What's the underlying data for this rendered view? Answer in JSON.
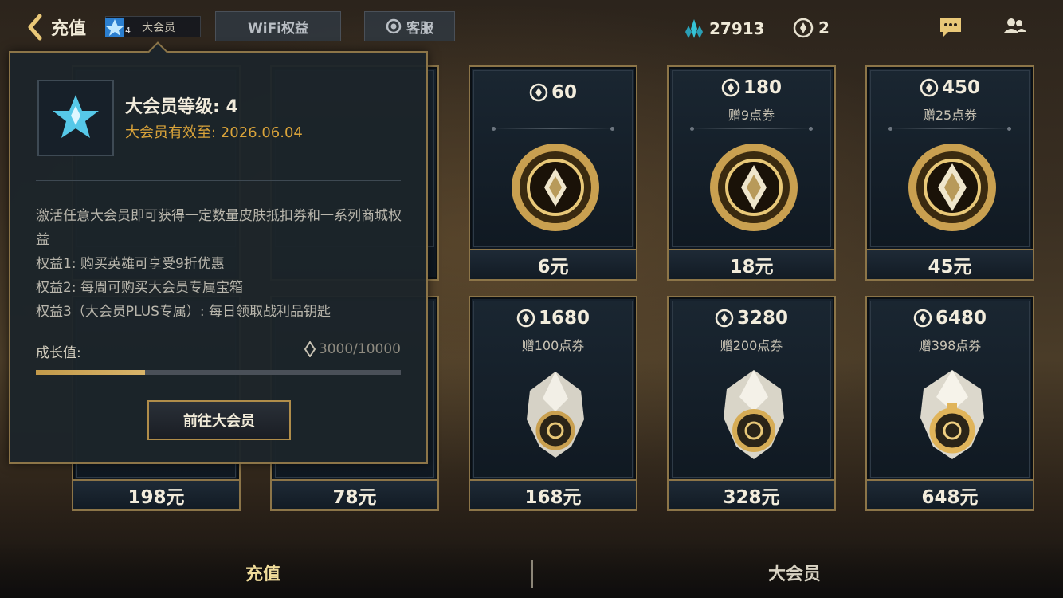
{
  "header": {
    "title": "充值",
    "vip_chip": {
      "level": "4",
      "label": "大会员"
    },
    "wifi_tab": "WiFi权益",
    "service_tab": "客服",
    "diamonds": "27913",
    "coupons": "2"
  },
  "cards": [
    {
      "amount": "",
      "bonus": "",
      "price": "198元",
      "visible": "partial"
    },
    {
      "amount": "",
      "bonus": "",
      "price": "78元",
      "visible": "partial"
    },
    {
      "amount": "60",
      "bonus": "",
      "price": "6元"
    },
    {
      "amount": "180",
      "bonus": "赠9点券",
      "price": "18元"
    },
    {
      "amount": "450",
      "bonus": "赠25点券",
      "price": "45元"
    },
    {
      "amount": "1680",
      "bonus": "赠100点券",
      "price": "168元"
    },
    {
      "amount": "3280",
      "bonus": "赠200点券",
      "price": "328元"
    },
    {
      "amount": "6480",
      "bonus": "赠398点券",
      "price": "648元"
    }
  ],
  "popup": {
    "level_text": "大会员等级: 4",
    "expiry_text": "大会员有效至: 2026.06.04",
    "desc": [
      "激活任意大会员即可获得一定数量皮肤抵扣券和一系列商城权益",
      "权益1: 购买英雄可享受9折优惠",
      "权益2: 每周可购买大会员专属宝箱",
      "权益3（大会员PLUS专属）: 每日领取战利品钥匙"
    ],
    "growth_label": "成长值:",
    "growth_value": "3000/10000",
    "growth_fraction": 0.3,
    "button": "前往大会员"
  },
  "bottom_tabs": {
    "recharge": "充值",
    "vip": "大会员"
  },
  "colors": {
    "gold": "#8c7548",
    "accent_yellow": "#d9a33a",
    "diamond_cyan": "#2fb6c9"
  },
  "icons": [
    "back-chevron-icon",
    "vip-star-icon",
    "headset-icon",
    "diamond-icon",
    "coupon-icon",
    "chat-icon",
    "friends-icon"
  ]
}
